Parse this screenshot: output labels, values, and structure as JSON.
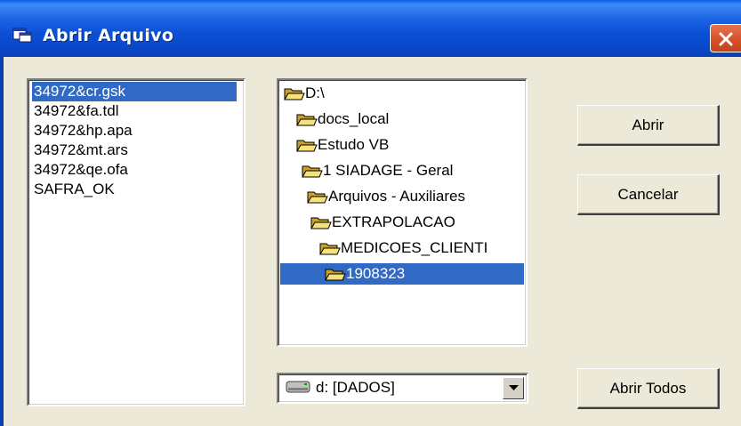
{
  "window": {
    "title": "Abrir Arquivo",
    "title_icon": "app-window-icon",
    "close_icon": "close-icon",
    "colors": {
      "titlebar": "#0a4fd4",
      "close": "#d8542b",
      "face": "#ece9d8",
      "selection": "#316ac5"
    }
  },
  "file_list": {
    "items": [
      {
        "label": "34972&cr.gsk",
        "selected": true
      },
      {
        "label": "34972&fa.tdl"
      },
      {
        "label": "34972&hp.apa"
      },
      {
        "label": "34972&mt.ars"
      },
      {
        "label": "34972&qe.ofa"
      },
      {
        "label": "SAFRA_OK"
      }
    ]
  },
  "folder_tree": {
    "items": [
      {
        "label": "D:\\",
        "icon": "open-folder-icon"
      },
      {
        "label": "docs_local",
        "icon": "open-folder-icon"
      },
      {
        "label": "Estudo VB",
        "icon": "open-folder-icon"
      },
      {
        "label": "1 SIADAGE - Geral",
        "icon": "open-folder-icon"
      },
      {
        "label": "Arquivos - Auxiliares",
        "icon": "open-folder-icon"
      },
      {
        "label": "EXTRAPOLACAO",
        "icon": "open-folder-icon"
      },
      {
        "label": "MEDICOES_CLIENTI",
        "icon": "open-folder-icon"
      },
      {
        "label": "1908323",
        "icon": "open-folder-icon",
        "selected": true
      }
    ]
  },
  "drive_select": {
    "value": "d: [DADOS]",
    "icon": "drive-icon",
    "arrow_icon": "dropdown-arrow-icon"
  },
  "buttons": {
    "open": "Abrir",
    "cancel": "Cancelar",
    "open_all": "Abrir Todos"
  }
}
